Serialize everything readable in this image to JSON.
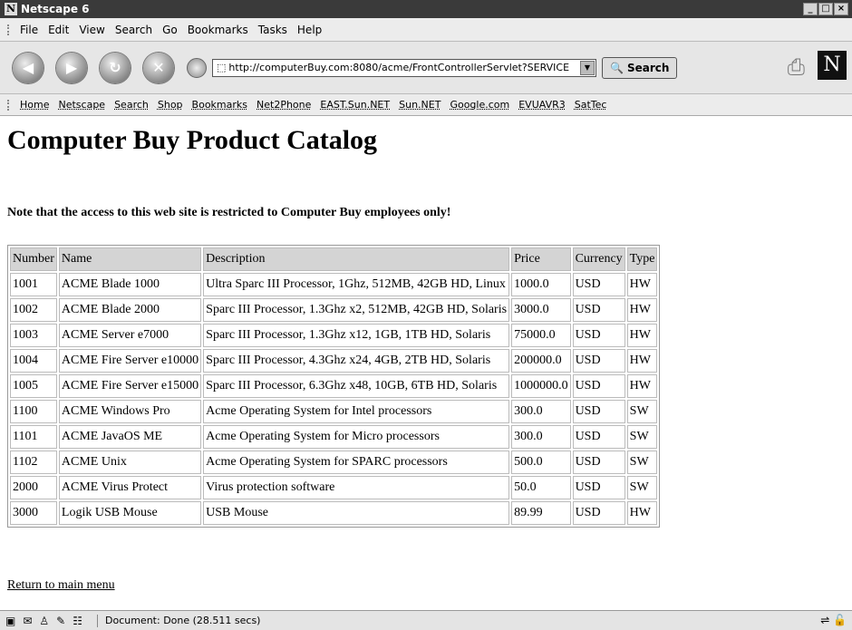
{
  "window": {
    "title": "Netscape 6",
    "logo": "N",
    "buttons": [
      "_",
      "□",
      "×"
    ]
  },
  "menu": {
    "items": [
      "File",
      "Edit",
      "View",
      "Search",
      "Go",
      "Bookmarks",
      "Tasks",
      "Help"
    ]
  },
  "nav": {
    "back_icon": "back-arrow-icon",
    "url": "http://computerBuy.com:8080/acme/FrontControllerServlet?SERVICE",
    "search_label": "Search",
    "throbber": "N"
  },
  "personal_toolbar": {
    "items": [
      "Home",
      "Netscape",
      "Search",
      "Shop",
      "Bookmarks",
      "Net2Phone",
      "EAST.Sun.NET",
      "Sun.NET",
      "Google.com",
      "EVUAVR3",
      "SatTec"
    ]
  },
  "page": {
    "heading": "Computer Buy Product Catalog",
    "note": "Note that the access to this web site is restricted to Computer Buy employees only!",
    "return_link": "Return to main menu"
  },
  "table": {
    "headers": [
      "Number",
      "Name",
      "Description",
      "Price",
      "Currency",
      "Type"
    ],
    "rows": [
      [
        "1001",
        "ACME Blade 1000",
        "Ultra Sparc III Processor, 1Ghz, 512MB, 42GB HD, Linux",
        "1000.0",
        "USD",
        "HW"
      ],
      [
        "1002",
        "ACME Blade 2000",
        "Sparc III Processor, 1.3Ghz x2, 512MB, 42GB HD, Solaris",
        "3000.0",
        "USD",
        "HW"
      ],
      [
        "1003",
        "ACME Server e7000",
        "Sparc III Processor, 1.3Ghz x12, 1GB, 1TB HD, Solaris",
        "75000.0",
        "USD",
        "HW"
      ],
      [
        "1004",
        "ACME Fire Server e10000",
        "Sparc III Processor, 4.3Ghz x24, 4GB, 2TB HD, Solaris",
        "200000.0",
        "USD",
        "HW"
      ],
      [
        "1005",
        "ACME Fire Server e15000",
        "Sparc III Processor, 6.3Ghz x48, 10GB, 6TB HD, Solaris",
        "1000000.0",
        "USD",
        "HW"
      ],
      [
        "1100",
        "ACME Windows Pro",
        "Acme Operating System for Intel processors",
        "300.0",
        "USD",
        "SW"
      ],
      [
        "1101",
        "ACME JavaOS ME",
        "Acme Operating System for Micro processors",
        "300.0",
        "USD",
        "SW"
      ],
      [
        "1102",
        "ACME Unix",
        "Acme Operating System for SPARC processors",
        "500.0",
        "USD",
        "SW"
      ],
      [
        "2000",
        "ACME Virus Protect",
        "Virus protection software",
        "50.0",
        "USD",
        "SW"
      ],
      [
        "3000",
        "Logik USB Mouse",
        "USB Mouse",
        "89.99",
        "USD",
        "HW"
      ]
    ]
  },
  "status": {
    "text": "Document: Done (28.511 secs)"
  }
}
